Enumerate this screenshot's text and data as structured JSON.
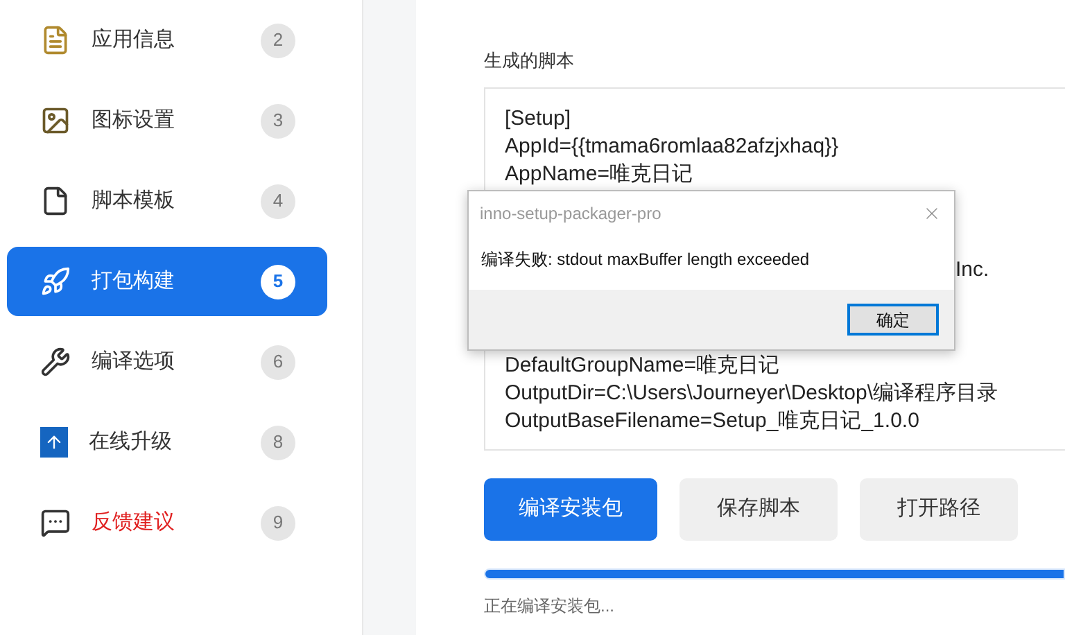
{
  "sidebar": {
    "items": [
      {
        "label": "应用信息",
        "badge": "2",
        "selected": false,
        "warning": false
      },
      {
        "label": "图标设置",
        "badge": "3",
        "selected": false,
        "warning": false
      },
      {
        "label": "脚本模板",
        "badge": "4",
        "selected": false,
        "warning": false
      },
      {
        "label": "打包构建",
        "badge": "5",
        "selected": true,
        "warning": false
      },
      {
        "label": "编译选项",
        "badge": "6",
        "selected": false,
        "warning": false
      },
      {
        "label": "在线升级",
        "badge": "8",
        "selected": false,
        "warning": false
      },
      {
        "label": "反馈建议",
        "badge": "9",
        "selected": false,
        "warning": true
      }
    ]
  },
  "script": {
    "label": "生成的脚本",
    "lines_above": [
      "[Setup]",
      "AppId={{tmama6romlaa82afzjxhaq}}",
      "AppName=唯克日记"
    ],
    "partial_text": "Inc.",
    "lines_below": [
      "DefaultGroupName=唯克日记",
      "OutputDir=C:\\Users\\Journeyer\\Desktop\\编译程序目录",
      "OutputBaseFilename=Setup_唯克日记_1.0.0"
    ]
  },
  "buttons": [
    {
      "label": "编译安装包",
      "primary": true
    },
    {
      "label": "保存脚本",
      "primary": false
    },
    {
      "label": "打开路径",
      "primary": false
    }
  ],
  "progress": {
    "level": 1
  },
  "status": "正在编译安装包...",
  "dialog": {
    "title": "inno-setup-packager-pro",
    "message": "编译失败: stdout maxBuffer length exceeded",
    "ok_button": "确定"
  }
}
